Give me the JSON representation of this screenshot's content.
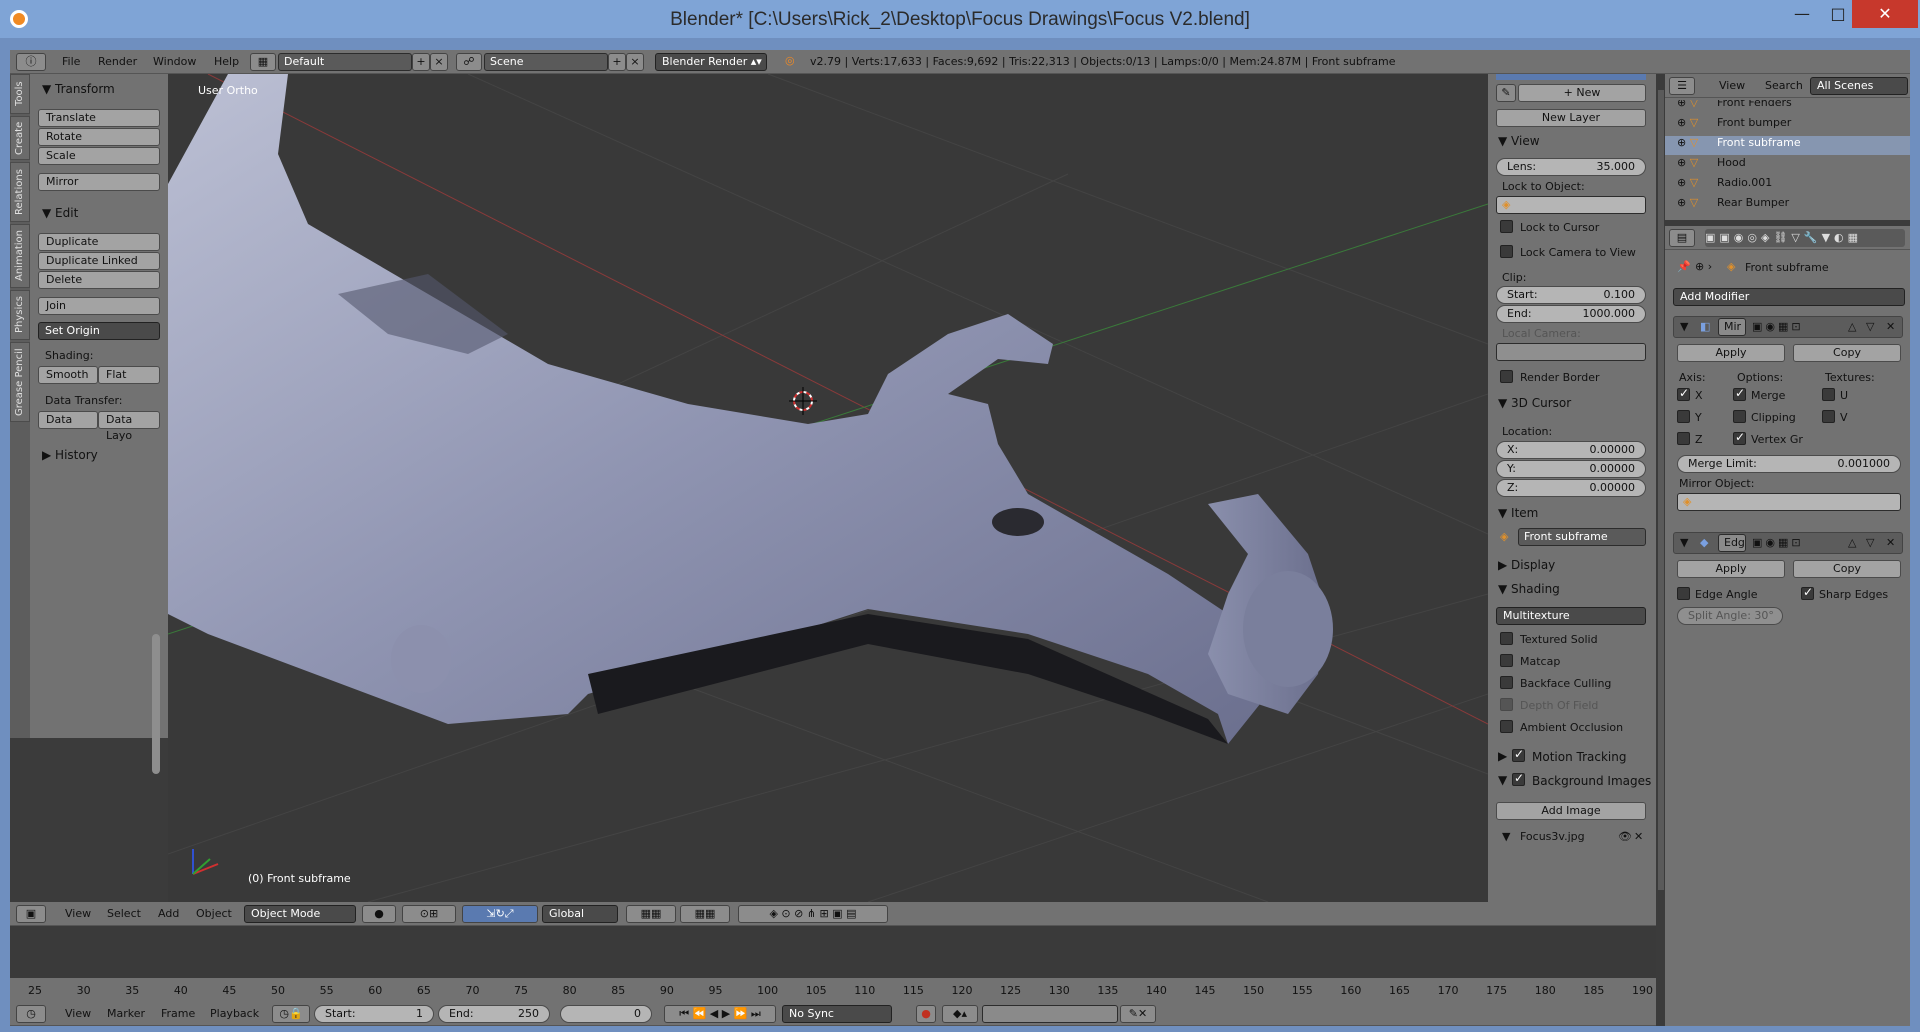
{
  "window": {
    "title": "Blender* [C:\\Users\\Rick_2\\Desktop\\Focus Drawings\\Focus V2.blend]",
    "min": "—",
    "max": "□",
    "close": "✕"
  },
  "info_header": {
    "menus": [
      "File",
      "Render",
      "Window",
      "Help"
    ],
    "layout": "Default",
    "scene": "Scene",
    "engine": "Blender Render",
    "stats": "v2.79 | Verts:17,633 | Faces:9,692 | Tris:22,313 | Objects:0/13 | Lamps:0/0 | Mem:24.87M | Front subframe"
  },
  "tabs": [
    "Tools",
    "Create",
    "Relations",
    "Animation",
    "Physics",
    "Grease Pencil"
  ],
  "toolshelf": {
    "transform": "Transform",
    "translate": "Translate",
    "rotate": "Rotate",
    "scale": "Scale",
    "mirror": "Mirror",
    "edit": "Edit",
    "duplicate": "Duplicate",
    "duplicate_linked": "Duplicate Linked",
    "delete": "Delete",
    "join": "Join",
    "set_origin": "Set Origin",
    "shading": "Shading:",
    "smooth": "Smooth",
    "flat": "Flat",
    "data_transfer": "Data Transfer:",
    "data": "Data",
    "data_layo": "Data Layo",
    "history": "History"
  },
  "viewport": {
    "view_label": "User Ortho",
    "object_label": "(0) Front subframe"
  },
  "npanel": {
    "new": "New",
    "new_layer": "New Layer",
    "view": "View",
    "lens_label": "Lens:",
    "lens_value": "35.000",
    "lock_to_object": "Lock to Object:",
    "lock_to_cursor": "Lock to Cursor",
    "lock_camera": "Lock Camera to View",
    "clip": "Clip:",
    "start_label": "Start:",
    "start_value": "0.100",
    "end_label": "End:",
    "end_value": "1000.000",
    "local_camera": "Local Camera:",
    "render_border": "Render Border",
    "cursor3d": "3D Cursor",
    "location": "Location:",
    "x_label": "X:",
    "x_value": "0.00000",
    "y_label": "Y:",
    "y_value": "0.00000",
    "z_label": "Z:",
    "z_value": "0.00000",
    "item": "Item",
    "item_name": "Front subframe",
    "display": "Display",
    "shading": "Shading",
    "shading_mode": "Multitexture",
    "textured_solid": "Textured Solid",
    "matcap": "Matcap",
    "backface": "Backface Culling",
    "dof": "Depth Of Field",
    "ao": "Ambient Occlusion",
    "motion_tracking": "Motion Tracking",
    "bg_images": "Background Images",
    "add_image": "Add Image",
    "image_name": "Focus3v.jpg"
  },
  "outliner": {
    "menus": [
      "View",
      "Search"
    ],
    "filter": "All Scenes",
    "items": [
      "Front Fenders",
      "Front bumper",
      "Front subframe",
      "Hood",
      "Radio.001",
      "Rear Bumper"
    ]
  },
  "properties": {
    "object_name": "Front subframe",
    "add_modifier": "Add Modifier",
    "mod1_name": "Mir",
    "apply": "Apply",
    "copy": "Copy",
    "axis": "Axis:",
    "options": "Options:",
    "textures": "Textures:",
    "x": "X",
    "y": "Y",
    "z": "Z",
    "merge": "Merge",
    "clipping": "Clipping",
    "vertex_gr": "Vertex Gr",
    "u": "U",
    "v": "V",
    "merge_limit_label": "Merge Limit:",
    "merge_limit_value": "0.001000",
    "mirror_object": "Mirror Object:",
    "mod2_name": "Edg",
    "edge_angle": "Edge Angle",
    "sharp_edges": "Sharp Edges",
    "split_angle": "Split Angle: 30°"
  },
  "view3d_header": {
    "menus": [
      "View",
      "Select",
      "Add",
      "Object"
    ],
    "mode": "Object Mode",
    "orientation": "Global"
  },
  "timeline": {
    "ticks": [
      "25",
      "30",
      "35",
      "40",
      "45",
      "50",
      "55",
      "60",
      "65",
      "70",
      "75",
      "80",
      "85",
      "90",
      "95",
      "100",
      "105",
      "110",
      "115",
      "120",
      "125",
      "130",
      "135",
      "140",
      "145",
      "150",
      "155",
      "160",
      "165",
      "170",
      "175",
      "180",
      "185",
      "190"
    ],
    "menus": [
      "View",
      "Marker",
      "Frame",
      "Playback"
    ],
    "start_label": "Start:",
    "start_value": "1",
    "end_label": "End:",
    "end_value": "250",
    "current": "0",
    "sync": "No Sync"
  }
}
